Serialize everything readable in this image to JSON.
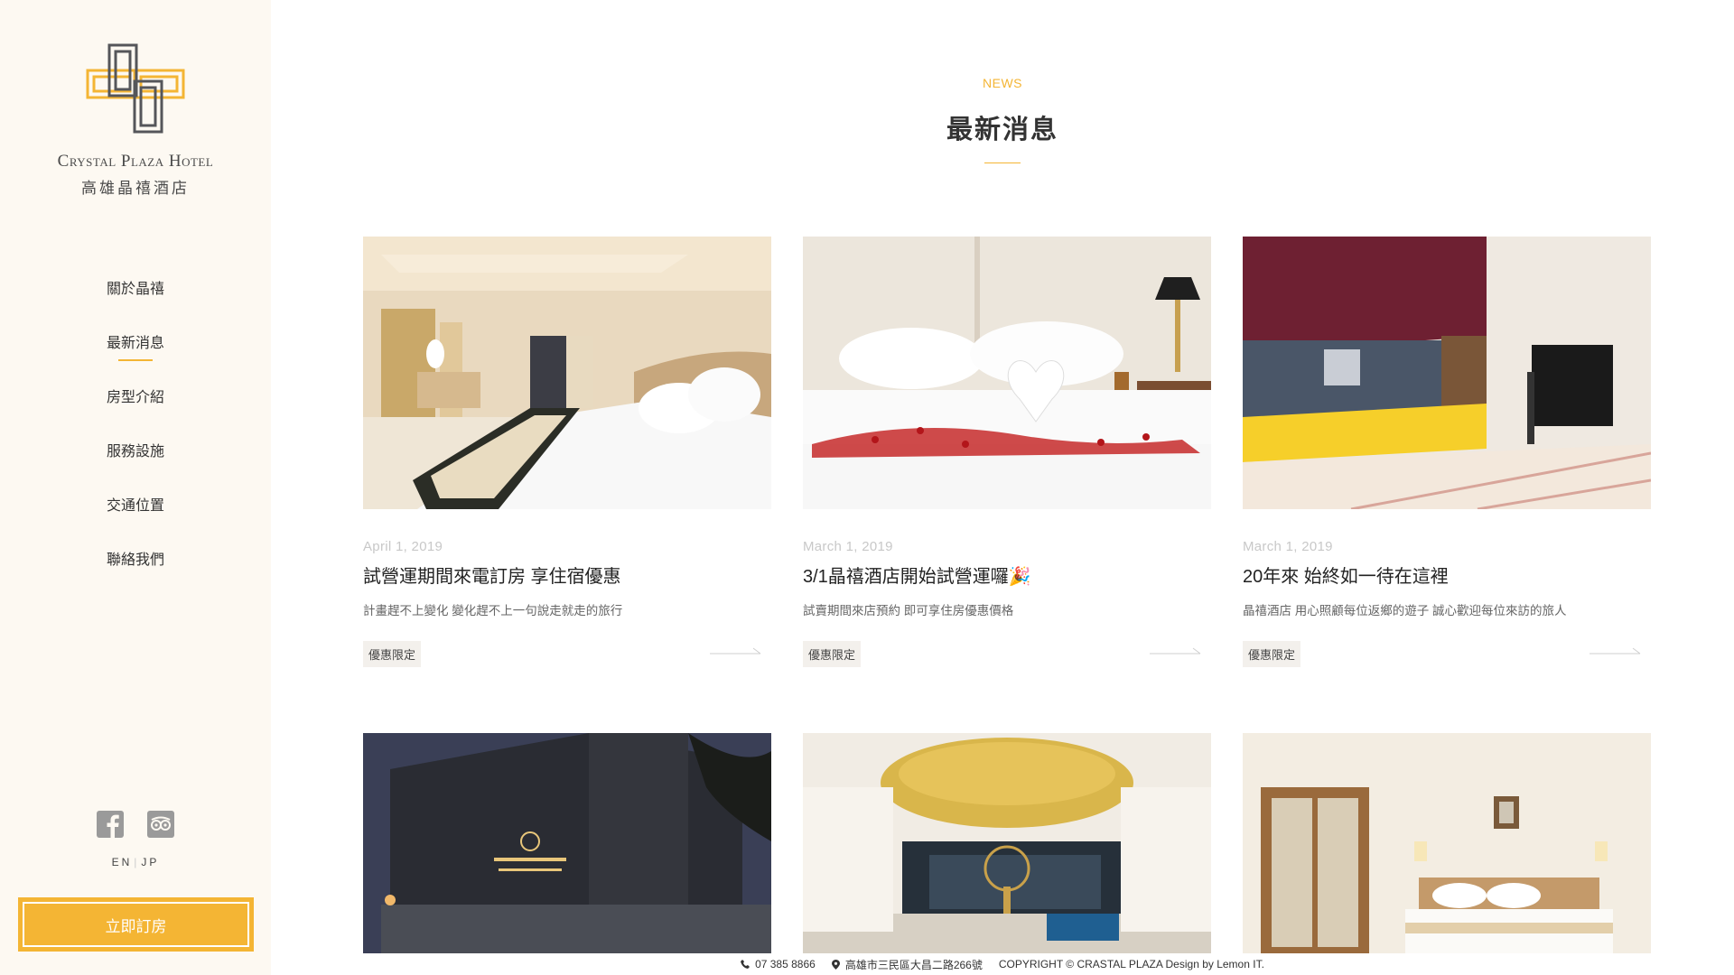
{
  "brand": {
    "name_en": "Crystal Plaza Hotel",
    "name_zh": "高雄晶禧酒店",
    "accent": "#f4b534",
    "dark": "#55565a"
  },
  "nav": {
    "items": [
      {
        "label": "關於晶禧",
        "active": false
      },
      {
        "label": "最新消息",
        "active": true
      },
      {
        "label": "房型介紹",
        "active": false
      },
      {
        "label": "服務設施",
        "active": false
      },
      {
        "label": "交通位置",
        "active": false
      },
      {
        "label": "聯絡我們",
        "active": false
      }
    ]
  },
  "social": {
    "facebook_icon": "facebook-icon",
    "tripadvisor_icon": "tripadvisor-icon"
  },
  "lang": {
    "en": "EN",
    "sep": "|",
    "jp": "JP"
  },
  "book_button": "立即訂房",
  "section": {
    "eyebrow": "NEWS",
    "title": "最新消息"
  },
  "news": [
    {
      "date": "April 1, 2019",
      "title": "試營運期間來電訂房 享住宿優惠",
      "desc": "計畫趕不上變化 變化趕不上一句說走就走的旅行",
      "tag": "優惠限定",
      "image": "suite-bedroom-photo"
    },
    {
      "date": "March 1, 2019",
      "title": "3/1晶禧酒店開始試營運囉🎉",
      "desc": "試賣期間來店預約 即可享住房優惠價格",
      "tag": "優惠限定",
      "image": "swan-towel-bed-photo"
    },
    {
      "date": "March 1, 2019",
      "title": "20年來 始終如一待在這裡",
      "desc": "晶禧酒店 用心照顧每位返鄉的遊子 誠心歡迎每位來訪的旅人",
      "tag": "優惠限定",
      "image": "front-desk-lobby-photo"
    }
  ],
  "news_row2": [
    {
      "image": "hotel-exterior-night-photo"
    },
    {
      "image": "lobby-chandelier-photo"
    },
    {
      "image": "double-room-photo"
    }
  ],
  "footer": {
    "phone": "07 385 8866",
    "address": "高雄市三民區大昌二路266號",
    "copyright": "COPYRIGHT © CRASTAL PLAZA Design by Lemon IT."
  }
}
